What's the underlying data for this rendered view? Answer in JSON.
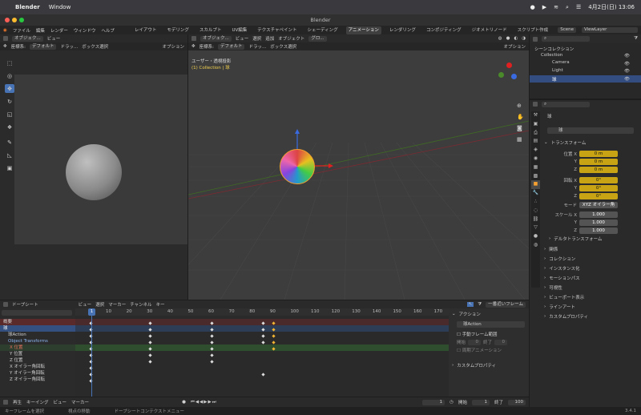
{
  "mac_menu": {
    "app": "Blender",
    "window": "Window",
    "clock": "4月2日(日) 13:06"
  },
  "window_title": "Blender",
  "menu": [
    "ファイル",
    "編集",
    "レンダー",
    "ウィンドウ",
    "ヘルプ"
  ],
  "workspaces": [
    "レイアウト",
    "モデリング",
    "スカルプト",
    "UV編集",
    "テクスチャペイント",
    "シェーディング",
    "アニメーション",
    "レンダリング",
    "コンポジティング",
    "ジオメトリノード",
    "スクリプト作成"
  ],
  "active_workspace": "アニメーション",
  "scene": "Scene",
  "view_layer": "ViewLayer",
  "left_view": {
    "mode": "オブジェク...",
    "view": "ビュー",
    "coords": "座標系:",
    "default": "デフォルト",
    "drag": "ドラッ...",
    "box": "ボックス選択",
    "options": "オプション"
  },
  "main_view": {
    "mode": "オブジェク...",
    "menus": [
      "ビュー",
      "選択",
      "追加",
      "オブジェクト"
    ],
    "glob": "グロ...",
    "coords": "座標系:",
    "default": "デフォルト",
    "drag": "ドラッ...",
    "box": "ボックス選択",
    "options": "オプション",
    "line1": "ユーザー・透視投影",
    "line2": "(1) Collection | 球"
  },
  "outliner": {
    "scene_collection": "シーンコレクション",
    "collection": "Collection",
    "items": [
      "Camera",
      "Light",
      "球"
    ]
  },
  "props": {
    "object_name": "球",
    "object_name2": "球",
    "transform_title": "トランスフォーム",
    "location_label": "位置 X",
    "y": "Y",
    "z": "Z",
    "loc": [
      "0 m",
      "0 m",
      "0 m"
    ],
    "rotation_label": "回転 X",
    "rot": [
      "0°",
      "0°",
      "0°"
    ],
    "mode_label": "モード",
    "mode_value": "XYZ オイラー角",
    "scale_label": "スケール X",
    "scale": [
      "1.000",
      "1.000",
      "1.000"
    ],
    "sections": [
      "デルタトランスフォーム",
      "関係",
      "コレクション",
      "インスタンス化",
      "モーションパス",
      "可視性",
      "ビューポート表示",
      "ラインアート",
      "カスタムプロパティ"
    ]
  },
  "dopesheet": {
    "mode": "ドープシート",
    "menus": [
      "ビュー",
      "選択",
      "マーカー",
      "チャンネル",
      "キー"
    ],
    "near_frame": "一番近いフレーム",
    "ticks": [
      "1",
      "10",
      "20",
      "30",
      "40",
      "50",
      "60",
      "70",
      "80",
      "90",
      "100",
      "110",
      "120",
      "130",
      "140",
      "150",
      "160",
      "170"
    ],
    "current_frame": "1",
    "channels": [
      "概要",
      "球",
      "球Action",
      "Object Transforms",
      "X 位置",
      "Y 位置",
      "Z 位置",
      "X オイラー角回転",
      "Y オイラー角回転",
      "Z オイラー角回転"
    ],
    "action_panel": {
      "title": "アクション",
      "name": "球Action",
      "manual": "手動フレーム範囲",
      "start": "開始",
      "end": "終了",
      "start_v": "0",
      "end_v": "0",
      "cyclic": "周期アニメーション",
      "custom": "カスタムプロパティ"
    }
  },
  "timeline": {
    "play": "再生",
    "keying": "キーイング",
    "view": "ビュー",
    "marker": "マーカー",
    "frame": "1",
    "start_label": "開始",
    "start": "1",
    "end_label": "終了",
    "end": "100"
  },
  "status": {
    "left": "キーフレームを選択",
    "mid": "視点の移動",
    "right": "ドープシートコンテクストメニュー",
    "version": "3.4.1"
  }
}
